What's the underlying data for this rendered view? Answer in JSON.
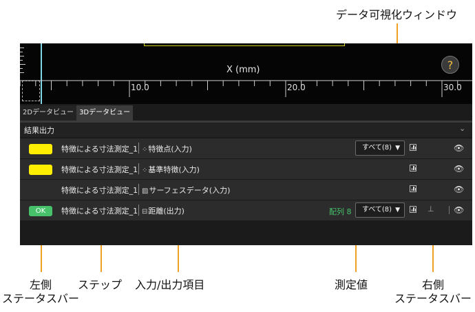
{
  "callouts": {
    "data_window": "データ可視化ウィンドウ",
    "left_status": "左側\nステータスバー",
    "step": "ステップ",
    "io": "入力/出力項目",
    "measured": "測定値",
    "right_status": "右側\nステータスバー"
  },
  "viewer": {
    "x_axis_label": "X (mm)",
    "ticks": [
      "10.0",
      "20.0",
      "30.0"
    ],
    "help": "?"
  },
  "tabs": [
    "2Dデータビュー",
    "3Dデータビュー"
  ],
  "results": {
    "title": "結果出力",
    "rows": [
      {
        "status": "",
        "step": "特徴による寸法測定_1",
        "io_icon": "⁘",
        "io": "特徴点(入力)",
        "array": "",
        "dropdown": "すべて(8)",
        "pin": false
      },
      {
        "status": "",
        "step": "特徴による寸法測定_1",
        "io_icon": "⁘",
        "io": "基準特徴(入力)",
        "array": "",
        "dropdown": "",
        "pin": false
      },
      {
        "status": "",
        "step": "特徴による寸法測定_1",
        "io_icon": "▨",
        "io": "サーフェスデータ(入力)",
        "array": "",
        "dropdown": "",
        "pin": false
      },
      {
        "status": "OK",
        "step": "特徴による寸法測定_1",
        "io_icon": "⊟",
        "io": "距離(出力)",
        "array": "配列 8",
        "dropdown": "すべて(8)",
        "pin": true
      }
    ]
  },
  "colors": {
    "accent": "#f0a020",
    "status_yellow": "#ffee00",
    "status_ok": "#47c26b",
    "cyan_line": "#7fd7e6"
  }
}
